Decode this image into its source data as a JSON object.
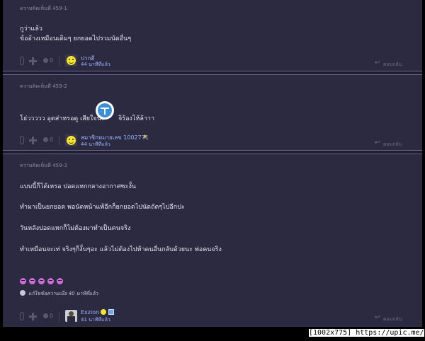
{
  "comments": [
    {
      "header": "ความคิดเห็นที่ 459-1",
      "lines": [
        "กูว่าแล้ว",
        "ข้ออ้างเหมือนเดิมๆ ยกยอดไปรวมนัดอื่นๆ"
      ],
      "votes": "0",
      "emotions": "0",
      "username": "ปากดี",
      "time": "44 นาทีที่แล้ว",
      "reply_label": "ตอบกลับ"
    },
    {
      "header": "ความคิดเห็นที่ 459-2",
      "lines": [
        "โธ่ววววว อุตส่าหรอดู เสียใจนะ",
        "จิร้องไห้ล้าาา"
      ],
      "votes": "0",
      "emotions": "0",
      "username": "สมาชิกหมายเลข 1002771",
      "time": "44 นาทีที่แล้ว",
      "reply_label": "ตอบกลับ"
    },
    {
      "header": "ความคิดเห็นที่ 459-3",
      "lines": [
        "แบบนี้ก็ได้เหรอ ปอดแหกกลางอากาศซะงั้น",
        "ทำมาเป็นยกยอด พอนัดหน้าแพ้อีกก็ยกยอดไปนัดถัดๆไปอีกปะ",
        "วันหลังปอดแหกก็ไม่ต้องมาทำเป็นคนจริง",
        "ทำเหมือนจะเท่ จริงๆก็งั้นๆอะ แล้วไม่ต้องไปท้าคนอื่นกลับด้วยนะ พ่อคนจริง"
      ],
      "edited_note": "แก้ไขข้อความเมื่อ 40 นาทีที่แล้ว",
      "votes": "0",
      "emotions": "0",
      "username": "Exzion",
      "time": "41 นาทีที่แล้ว",
      "reply_label": "ตอบกลับ"
    }
  ],
  "caption": "[1002x775] https://upic.me/",
  "colors": {
    "background": "#2c2a41",
    "separator": "#1d1c2c",
    "username": "#9ab4ff",
    "text": "#e6e4f2"
  }
}
